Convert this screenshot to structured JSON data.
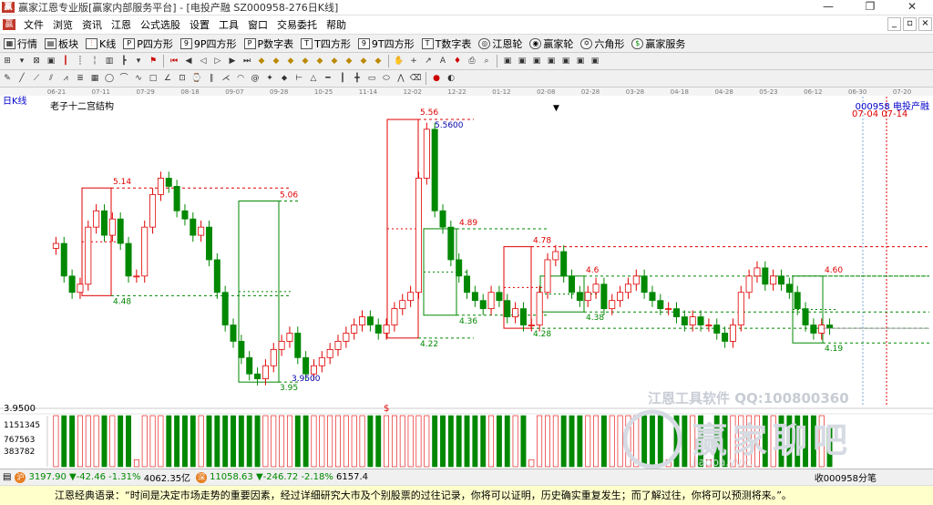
{
  "window": {
    "title": "赢家江恩专业版[赢家内部服务平台] - [电投产融  SZ000958-276日K线]",
    "min_icon": "minimize-icon",
    "max_icon": "restore-icon",
    "close_icon": "close-icon"
  },
  "menu": {
    "items": [
      "文件",
      "浏览",
      "资讯",
      "江恩",
      "公式选股",
      "设置",
      "工具",
      "窗口",
      "交易委托",
      "帮助"
    ]
  },
  "toolbar1": {
    "items": [
      {
        "label": "行情",
        "icon": "grid-icon"
      },
      {
        "label": "板块",
        "icon": "blocks-icon"
      },
      {
        "label": "K线",
        "icon": "candle-icon"
      },
      {
        "label": "P四方形",
        "icon": "p-square-icon"
      },
      {
        "label": "9P四方形",
        "icon": "9p-square-icon"
      },
      {
        "label": "P数字表",
        "icon": "p-table-icon"
      },
      {
        "label": "T四方形",
        "icon": "t-square-icon"
      },
      {
        "label": "9T四方形",
        "icon": "9t-square-icon"
      },
      {
        "label": "T数字表",
        "icon": "t-table-icon"
      },
      {
        "label": "江恩轮",
        "icon": "wheel-icon"
      },
      {
        "label": "赢家轮",
        "icon": "winner-wheel-icon"
      },
      {
        "label": "六角形",
        "icon": "hexagon-icon"
      },
      {
        "label": "赢家服务",
        "icon": "dollar-icon"
      }
    ]
  },
  "chart_panel": {
    "period_label": "日K线",
    "structure_label": "老子十二宫结构",
    "stock_code": "000958",
    "stock_name": "电投产融",
    "future_dates": "07-04 07-14",
    "top_axis_dates": [
      "06-21",
      "07-11",
      "07-29",
      "08-18",
      "09-07",
      "09-28",
      "10-25",
      "11-14",
      "12-02",
      "12-22",
      "01-12",
      "02-08",
      "02-28",
      "03-28",
      "04-18",
      "04-28",
      "05-23",
      "06-12",
      "06-30",
      "07-20"
    ],
    "low_price_label": "3.9500",
    "volume_ticks": [
      "1151345",
      "767563",
      "383782"
    ],
    "watermark_line1": "江恩工具软件  QQ:100800360",
    "watermark_line2": "赢家聊吧",
    "watermark_url": "jiaoba.yy.c…",
    "dollar_marker": "$"
  },
  "chart_data": {
    "type": "candlestick",
    "title": "老子十二宫结构",
    "series_name": "电投产融 000958",
    "price_range": [
      3.8,
      5.7
    ],
    "annotations": [
      {
        "label": "5.14",
        "kind": "high"
      },
      {
        "label": "4.48",
        "kind": "low"
      },
      {
        "label": "5.06",
        "kind": "high"
      },
      {
        "label": "3.9500",
        "kind": "low"
      },
      {
        "label": "3.95",
        "kind": "low"
      },
      {
        "label": "5.56",
        "kind": "high"
      },
      {
        "label": "5.5600",
        "kind": "high"
      },
      {
        "label": "4.22",
        "kind": "low"
      },
      {
        "label": "4.89",
        "kind": "high"
      },
      {
        "label": "4.36",
        "kind": "low"
      },
      {
        "label": "4.78",
        "kind": "high"
      },
      {
        "label": "4.28",
        "kind": "low"
      },
      {
        "label": "4.6",
        "kind": "high"
      },
      {
        "label": "4.38",
        "kind": "low"
      },
      {
        "label": "4.60",
        "kind": "high"
      },
      {
        "label": "4.19",
        "kind": "low"
      }
    ],
    "boxes": [
      {
        "high": 5.14,
        "low": 4.48,
        "color": "red"
      },
      {
        "high": 5.06,
        "low": 3.95,
        "color": "green"
      },
      {
        "high": 5.56,
        "low": 4.22,
        "color": "red"
      },
      {
        "high": 4.89,
        "low": 4.36,
        "color": "green"
      },
      {
        "high": 4.78,
        "low": 4.28,
        "color": "red"
      },
      {
        "high": 4.6,
        "low": 4.38,
        "color": "green"
      },
      {
        "high": 4.6,
        "low": 4.19,
        "color": "green"
      }
    ],
    "close_path": [
      4.8,
      4.6,
      4.5,
      4.55,
      4.9,
      5.0,
      4.85,
      4.95,
      4.8,
      4.6,
      4.6,
      4.9,
      5.1,
      5.2,
      5.15,
      5.0,
      4.95,
      4.85,
      4.9,
      4.7,
      4.5,
      4.3,
      4.2,
      4.1,
      4.0,
      3.97,
      4.05,
      4.15,
      4.2,
      4.25,
      4.1,
      4.0,
      4.05,
      4.1,
      4.15,
      4.2,
      4.25,
      4.3,
      4.35,
      4.3,
      4.25,
      4.3,
      4.4,
      4.45,
      4.5,
      5.2,
      5.5,
      5.0,
      4.9,
      4.7,
      4.6,
      4.5,
      4.45,
      4.4,
      4.5,
      4.45,
      4.35,
      4.4,
      4.3,
      4.3,
      4.5,
      4.7,
      4.75,
      4.6,
      4.5,
      4.45,
      4.5,
      4.55,
      4.4,
      4.45,
      4.5,
      4.55,
      4.6,
      4.5,
      4.45,
      4.4,
      4.4,
      4.35,
      4.3,
      4.35,
      4.3,
      4.3,
      4.25,
      4.2,
      4.3,
      4.5,
      4.6,
      4.65,
      4.55,
      4.6,
      4.55,
      4.5,
      4.4,
      4.3,
      4.25,
      4.3,
      4.28
    ]
  },
  "status": {
    "index1_value": "3197.90",
    "index1_change": "▼-42.46",
    "index1_pct": "-1.31%",
    "index1_amount": "4062.35亿",
    "index2_value": "11058.63",
    "index2_change": "▼-246.72",
    "index2_pct": "-2.18%",
    "index2_amount": "6157.4",
    "right_text": "收000958分笔"
  },
  "quote": {
    "text": "江恩经典语录：“时间是决定市场走势的重要因素，经过详细研究大市及个别股票的过往记录，你将可以证明，历史确实重复发生；而了解过往，你将可以预测将来。”。"
  },
  "colors": {
    "up": "#e00000",
    "down": "#008800",
    "dashed_red": "#e00000",
    "dashed_green": "#008800"
  }
}
